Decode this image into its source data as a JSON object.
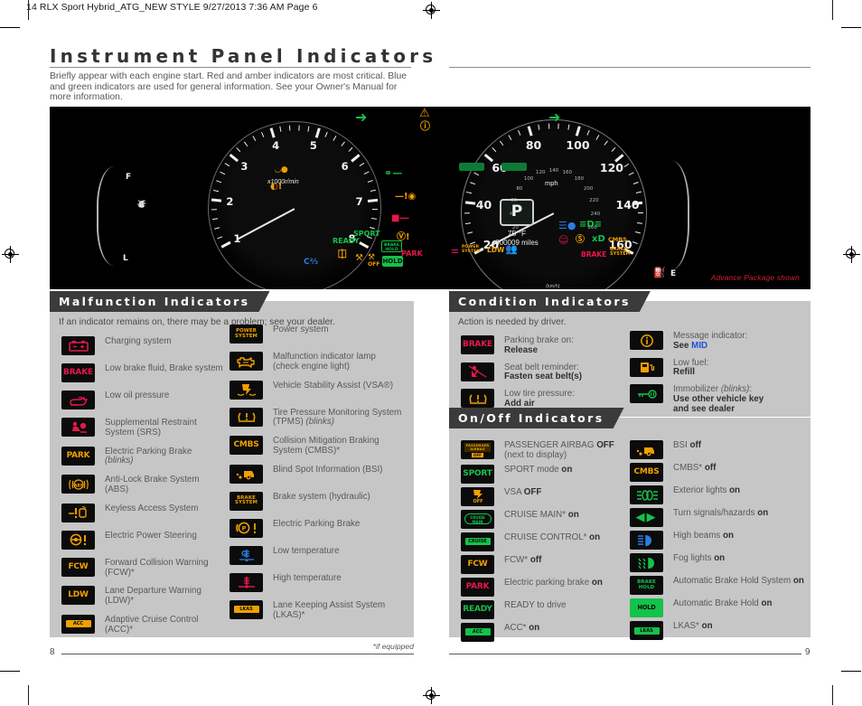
{
  "crop_header": "14 RLX Sport Hybrid_ATG_NEW STYLE  9/27/2013  7:36 AM  Page 6",
  "page": {
    "title": "Instrument Panel Indicators",
    "intro": "Briefly appear with each engine start. Red and amber indicators are most critical. Blue and green indicators are used for general information. See your Owner's Manual for more information.",
    "footnote": "*if equipped",
    "left_page_number": "8",
    "right_page_number": "9"
  },
  "photo": {
    "caption": "Advance Package shown",
    "tachometer": {
      "unit": "x1000r/min",
      "ticks": [
        "1",
        "2",
        "3",
        "4",
        "5",
        "6",
        "7",
        "8"
      ]
    },
    "speedometer": {
      "unit": "mph",
      "sub_unit": "(km/h)",
      "ticks": [
        "20",
        "40",
        "60",
        "80",
        "100",
        "120",
        "140",
        "160"
      ],
      "sub_ticks": [
        "20",
        "40",
        "60",
        "80",
        "100",
        "120",
        "140",
        "160",
        "180",
        "200",
        "220",
        "240",
        "260"
      ]
    },
    "mid": {
      "gear": "P",
      "temperature": "75 °F",
      "odometer": "000009 miles"
    },
    "fuel_gauge": {
      "full": "F",
      "low": "L",
      "empty": "E"
    },
    "lit_lamps": [
      "ACC",
      "LKAS",
      "SPORT",
      "READY",
      "PARK",
      "HOLD",
      "BRAKE HOLD",
      "LDW",
      "POWER SYSTEM",
      "CMBS",
      "BRAKE",
      "BRAKE SYSTEM"
    ]
  },
  "malfunction": {
    "heading": "Malfunction Indicators",
    "subheading": "If an indicator remains on, there may be a problem; see your dealer.",
    "left_items": [
      {
        "icon": "charging-system-icon",
        "glyph": "battery",
        "color": "#e8174a",
        "label_html": "Charging system"
      },
      {
        "icon": "brake-icon",
        "glyph": "text",
        "text": "BRAKE",
        "color": "#e8174a",
        "label_html": "Low brake fluid, Brake system"
      },
      {
        "icon": "low-oil-pressure-icon",
        "glyph": "oilcan",
        "color": "#e8174a",
        "label_html": "Low oil pressure"
      },
      {
        "icon": "srs-icon",
        "glyph": "srs",
        "color": "#e8174a",
        "label_html": "Supplemental Restraint<br>System (SRS)"
      },
      {
        "icon": "electric-parking-brake-icon",
        "glyph": "text",
        "text": "PARK",
        "color": "#f0a000",
        "label_html": "Electric Parking Brake<br><i>(blinks)</i>"
      },
      {
        "icon": "abs-icon",
        "glyph": "abs",
        "color": "#f0a000",
        "label_html": "Anti-Lock Brake System<br>(ABS)"
      },
      {
        "icon": "keyless-access-icon",
        "glyph": "keyless",
        "color": "#f0a000",
        "label_html": "Keyless Access System"
      },
      {
        "icon": "electric-power-steering-icon",
        "glyph": "eps",
        "color": "#f0a000",
        "label_html": "Electric Power Steering"
      },
      {
        "icon": "fcw-icon",
        "glyph": "text",
        "text": "FCW",
        "color": "#f0a000",
        "label_html": "Forward Collision Warning<br>(FCW)*"
      },
      {
        "icon": "ldw-icon",
        "glyph": "text",
        "text": "LDW",
        "color": "#f0a000",
        "label_html": "Lane Departure Warning<br>(LDW)*"
      },
      {
        "icon": "acc-icon",
        "glyph": "bar",
        "text": "ACC",
        "color": "#f0a000",
        "label_html": "Adaptive Cruise Control<br>(ACC)*"
      }
    ],
    "right_items": [
      {
        "icon": "power-system-icon",
        "glyph": "text2",
        "text": "POWER\nSYSTEM",
        "color": "#f0a000",
        "label_html": "Power system"
      },
      {
        "icon": "malfunction-indicator-lamp-icon",
        "glyph": "engine",
        "color": "#f0a000",
        "label_html": "Malfunction indicator lamp<br>(check engine light)"
      },
      {
        "icon": "vsa-icon",
        "glyph": "vsa",
        "color": "#f0a000",
        "label_html": "Vehicle Stability Assist (VSA®)"
      },
      {
        "icon": "tpms-icon",
        "glyph": "tpms",
        "color": "#f0a000",
        "label_html": "Tire Pressure Monitoring System<br>(TPMS) <i>(blinks)</i>"
      },
      {
        "icon": "cmbs-icon",
        "glyph": "text",
        "text": "CMBS",
        "color": "#f0a000",
        "label_html": "Collision Mitigation Braking<br>System (CMBS)*"
      },
      {
        "icon": "bsi-icon",
        "glyph": "bsi",
        "color": "#f0a000",
        "label_html": "Blind Spot Information (BSI)"
      },
      {
        "icon": "brake-system-icon",
        "glyph": "text2",
        "text": "BRAKE\nSYSTEM",
        "color": "#f0a000",
        "label_html": "Brake system (hydraulic)"
      },
      {
        "icon": "electric-parking-brake-p-icon",
        "glyph": "pbang",
        "color": "#f0a000",
        "label_html": "Electric Parking Brake"
      },
      {
        "icon": "low-temperature-icon",
        "glyph": "lowtemp",
        "color": "#2a7de1",
        "label_html": "Low temperature"
      },
      {
        "icon": "high-temperature-icon",
        "glyph": "hightemp",
        "color": "#e8174a",
        "label_html": "High temperature"
      },
      {
        "icon": "lkas-icon",
        "glyph": "bar",
        "text": "LKAS",
        "color": "#f0a000",
        "label_html": "Lane Keeping Assist System<br>(LKAS)*"
      }
    ]
  },
  "condition": {
    "heading": "Condition Indicators",
    "subheading": "Action is needed by driver.",
    "left_items": [
      {
        "icon": "brake-icon",
        "glyph": "text",
        "text": "BRAKE",
        "color": "#e8174a",
        "label_html": "Parking brake on:<br><b>Release</b>"
      },
      {
        "icon": "seat-belt-reminder-icon",
        "glyph": "seatbelt",
        "color": "#e8174a",
        "label_html": "Seat belt reminder:<br><b>Fasten seat belt(s)</b>"
      },
      {
        "icon": "tpms-icon",
        "glyph": "tpms",
        "color": "#f0a000",
        "label_html": "Low tire pressure:<br><b>Add air</b>"
      }
    ],
    "right_items": [
      {
        "icon": "message-indicator-icon",
        "glyph": "info",
        "color": "#f0a000",
        "label_html": "Message indicator:<br><b>See <span class=\"blue\">MID</span></b>"
      },
      {
        "icon": "low-fuel-icon",
        "glyph": "fuel",
        "color": "#f0a000",
        "label_html": "Low fuel:<br><b>Refill</b>"
      },
      {
        "icon": "immobilizer-icon",
        "glyph": "key",
        "color": "#14c24a",
        "label_html": "Immobilizer <i>(blinks)</i>:<br><b>Use other vehicle key<br>and see dealer</b>"
      }
    ]
  },
  "onoff": {
    "heading": "On/Off Indicators",
    "left_items": [
      {
        "icon": "passenger-airbag-off-icon",
        "glyph": "airbagoff",
        "color": "#f0a000",
        "label_html": "PASSENGER AIRBAG <b>OFF</b><br>(next to display)"
      },
      {
        "icon": "sport-mode-icon",
        "glyph": "text",
        "text": "SPORT",
        "color": "#14c24a",
        "label_html": "SPORT mode <b>on</b>"
      },
      {
        "icon": "vsa-off-icon",
        "glyph": "vsaoff",
        "color": "#f0a000",
        "label_html": "VSA <b>OFF</b>"
      },
      {
        "icon": "cruise-main-icon",
        "glyph": "bar2",
        "text": "CRUISE\nMAIN",
        "color": "#14c24a",
        "label_html": "CRUISE MAIN* <b>on</b>"
      },
      {
        "icon": "cruise-control-icon",
        "glyph": "bar",
        "text": "CRUISE CONTROL",
        "color": "#14c24a",
        "label_html": "CRUISE CONTROL* <b>on</b>"
      },
      {
        "icon": "fcw-icon",
        "glyph": "text",
        "text": "FCW",
        "color": "#f0a000",
        "label_html": "FCW* <b>off</b>"
      },
      {
        "icon": "park-icon",
        "glyph": "text",
        "text": "PARK",
        "color": "#e8174a",
        "label_html": "Electric parking brake <b>on</b>"
      },
      {
        "icon": "ready-icon",
        "glyph": "text",
        "text": "READY",
        "color": "#14c24a",
        "label_html": "READY to drive"
      },
      {
        "icon": "acc-icon",
        "glyph": "bar",
        "text": "ACC",
        "color": "#14c24a",
        "label_html": "ACC* <b>on</b>"
      }
    ],
    "right_items": [
      {
        "icon": "bsi-icon",
        "glyph": "bsi",
        "color": "#f0a000",
        "label_html": "BSI <b>off</b>"
      },
      {
        "icon": "cmbs-icon",
        "glyph": "text",
        "text": "CMBS",
        "color": "#f0a000",
        "label_html": "CMBS* <b>off</b>"
      },
      {
        "icon": "exterior-lights-icon",
        "glyph": "extlights",
        "color": "#14c24a",
        "label_html": "Exterior lights <b>on</b>"
      },
      {
        "icon": "turn-signals-icon",
        "glyph": "arrows",
        "color": "#14c24a",
        "label_html": "Turn signals/hazards <b>on</b>"
      },
      {
        "icon": "high-beams-icon",
        "glyph": "highbeam",
        "color": "#2a7de1",
        "label_html": "High beams <b>on</b>"
      },
      {
        "icon": "fog-lights-icon",
        "glyph": "fog",
        "color": "#14c24a",
        "label_html": "Fog lights <b>on</b>"
      },
      {
        "icon": "automatic-brake-hold-system-icon",
        "glyph": "text2",
        "text": "BRAKE\nHOLD",
        "color": "#14c24a",
        "label_html": "Automatic Brake Hold System <b>on</b>"
      },
      {
        "icon": "automatic-brake-hold-icon",
        "glyph": "filltext",
        "text": "HOLD",
        "color": "#0b0b0b",
        "label_html": "Automatic Brake Hold <b>on</b>"
      },
      {
        "icon": "lkas-icon",
        "glyph": "bar",
        "text": "LKAS",
        "color": "#14c24a",
        "label_html": "LKAS* <b>on</b>"
      }
    ]
  }
}
